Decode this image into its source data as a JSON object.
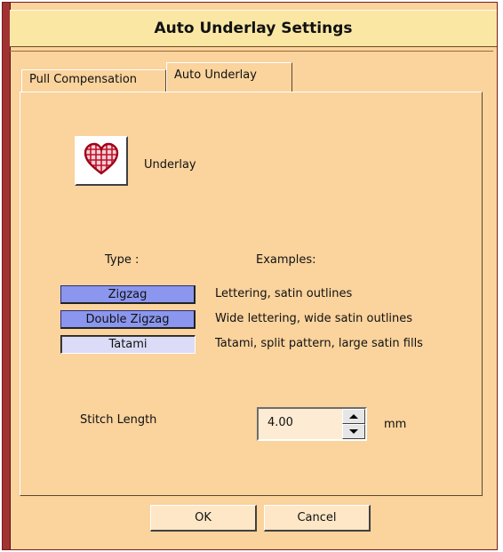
{
  "dialog": {
    "title": "Auto Underlay Settings"
  },
  "tabs": [
    {
      "label": "Pull Compensation",
      "active": false
    },
    {
      "label": "Auto Underlay",
      "active": true
    }
  ],
  "underlay": {
    "icon": "heart-grid-icon",
    "label": "Underlay"
  },
  "headings": {
    "type": "Type :",
    "examples": "Examples:"
  },
  "types": [
    {
      "label": "Zigzag",
      "example": "Lettering, satin outlines",
      "selected": false
    },
    {
      "label": "Double Zigzag",
      "example": "Wide lettering, wide satin outlines",
      "selected": false
    },
    {
      "label": "Tatami",
      "example": "Tatami, split pattern, large satin fills",
      "selected": true
    }
  ],
  "stitch": {
    "label": "Stitch Length",
    "value": "4.00",
    "unit": "mm"
  },
  "buttons": {
    "ok": "OK",
    "cancel": "Cancel"
  },
  "colors": {
    "dialog_bg": "#fad39d",
    "titlebar_bg": "#fbe7a4",
    "type_button": "#8b96ee",
    "type_button_selected": "#dcdcf8",
    "left_bar": "#a13333"
  }
}
